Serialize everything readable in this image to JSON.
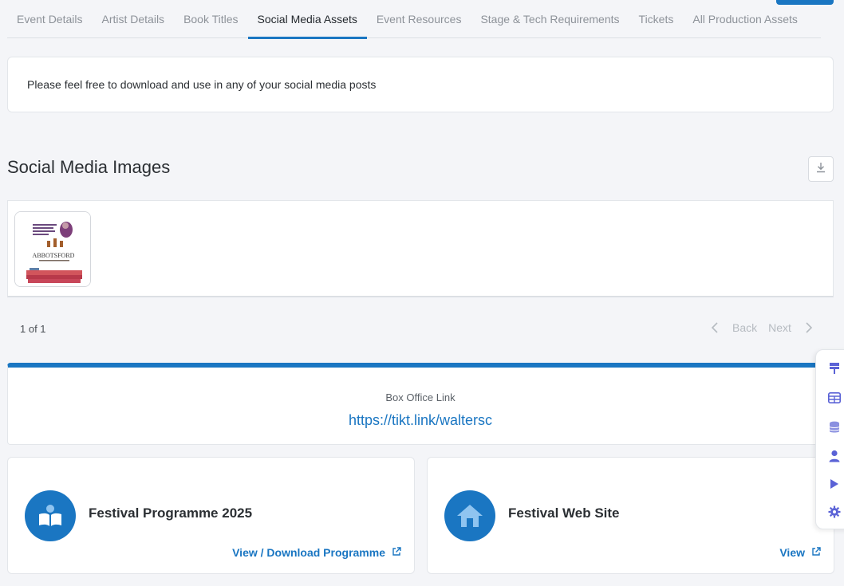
{
  "tabs": [
    {
      "label": "Event Details"
    },
    {
      "label": "Artist Details"
    },
    {
      "label": "Book Titles"
    },
    {
      "label": "Social Media Assets",
      "active": true
    },
    {
      "label": "Event Resources"
    },
    {
      "label": "Stage & Tech Requirements"
    },
    {
      "label": "Tickets"
    },
    {
      "label": "All Production Assets"
    }
  ],
  "info": {
    "text": "Please feel free to download and use in any of your social media posts"
  },
  "images_section": {
    "title": "Social Media Images",
    "thumbnail": {
      "logo_text": "ABBOTSFORD"
    }
  },
  "pager": {
    "count": "1 of 1",
    "back": "Back",
    "next": "Next"
  },
  "box_office": {
    "label": "Box Office Link",
    "link": "https://tikt.link/waltersc"
  },
  "programme_card": {
    "title": "Festival Programme 2025",
    "action": "View / Download Programme",
    "icon": "book-icon"
  },
  "website_card": {
    "title": "Festival Web Site",
    "action": "View",
    "icon": "home-icon"
  },
  "side_rail": [
    "pin-icon",
    "table-icon",
    "database-icon",
    "user-icon",
    "play-icon",
    "gear-icon"
  ],
  "colors": {
    "accent": "#1a76c2",
    "rail_icon": "#5a62d6",
    "background": "#f4f5f8"
  }
}
